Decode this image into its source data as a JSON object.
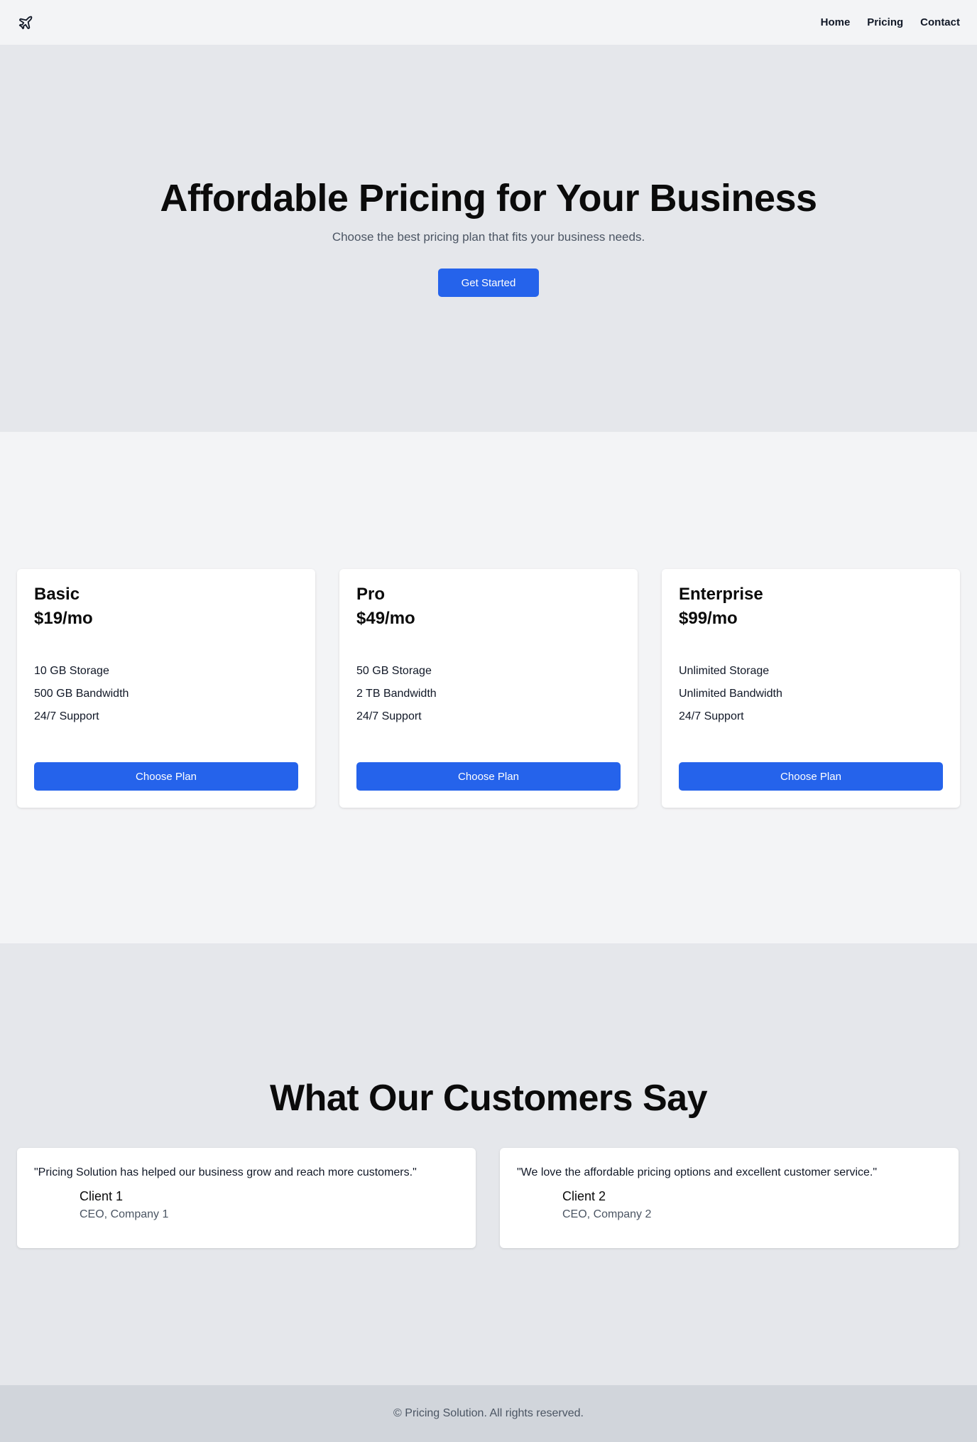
{
  "header": {
    "logo_icon": "airplane-icon",
    "nav": [
      {
        "label": "Home"
      },
      {
        "label": "Pricing"
      },
      {
        "label": "Contact"
      }
    ]
  },
  "hero": {
    "title": "Affordable Pricing for Your Business",
    "subtitle": "Choose the best pricing plan that fits your business needs.",
    "cta_label": "Get Started"
  },
  "plans": [
    {
      "name": "Basic",
      "price": "$19/mo",
      "features": [
        "10 GB Storage",
        "500 GB Bandwidth",
        "24/7 Support"
      ],
      "button_label": "Choose Plan"
    },
    {
      "name": "Pro",
      "price": "$49/mo",
      "features": [
        "50 GB Storage",
        "2 TB Bandwidth",
        "24/7 Support"
      ],
      "button_label": "Choose Plan"
    },
    {
      "name": "Enterprise",
      "price": "$99/mo",
      "features": [
        "Unlimited Storage",
        "Unlimited Bandwidth",
        "24/7 Support"
      ],
      "button_label": "Choose Plan"
    }
  ],
  "testimonials": {
    "title": "What Our Customers Say",
    "items": [
      {
        "quote": "\"Pricing Solution has helped our business grow and reach more customers.\"",
        "name": "Client 1",
        "role": "CEO, Company 1"
      },
      {
        "quote": "\"We love the affordable pricing options and excellent customer service.\"",
        "name": "Client 2",
        "role": "CEO, Company 2"
      }
    ]
  },
  "footer": {
    "text": "© Pricing Solution. All rights reserved."
  },
  "colors": {
    "accent": "#2563eb",
    "hero_bg": "#e5e7eb",
    "page_bg": "#f3f4f6",
    "footer_bg": "#d1d5db"
  }
}
